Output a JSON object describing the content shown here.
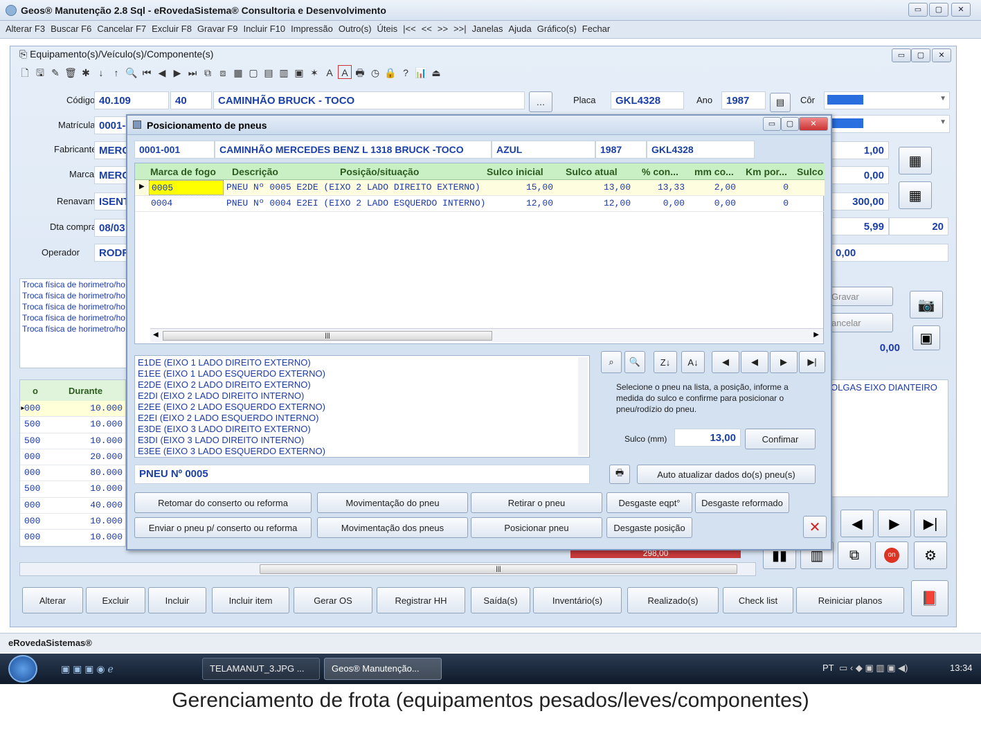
{
  "window": {
    "title": "Geos® Manutenção 2.8 Sql - eRovedaSistema® Consultoria e Desenvolvimento"
  },
  "menu": [
    "Alterar F3",
    "Buscar F6",
    "Cancelar F7",
    "Excluir F8",
    "Gravar F9",
    "Incluir F10",
    "Impressão",
    "Outro(s)",
    "Úteis",
    "|<<",
    "<<",
    ">>",
    ">>|",
    "Janelas",
    "Ajuda",
    "Gráfico(s)",
    "Fechar"
  ],
  "child": {
    "title": "Equipamento(s)/Veículo(s)/Componente(s)"
  },
  "form": {
    "codigo_label": "Código",
    "codigo": "40.109",
    "codigo2": "40",
    "descricao": "CAMINHÃO BRUCK - TOCO",
    "placa_label": "Placa",
    "placa": "GKL4328",
    "ano_label": "Ano",
    "ano": "1987",
    "cor_label": "Côr",
    "matricula_label": "Matrícula",
    "matricula": "0001-",
    "fabricante_label": "Fabricante",
    "fabricante": "MERC",
    "marca_label": "Marca",
    "marca": "MERC",
    "renavam_label": "Renavam",
    "renavam": "ISENT",
    "dtacompra_label": "Dta compra",
    "dtacompra": "08/03",
    "operador_label": "Operador",
    "operador": "RODR",
    "right_values": [
      "1,00",
      "0,00",
      "300,00",
      "5,99",
      "0,00"
    ],
    "right_extra": "20",
    "gravar": "Gravar",
    "cancelar": "ancelar",
    "right_total": "0,00",
    "troca": [
      "Troca física de horimetro/ho",
      "Troca física de horimetro/ho",
      "Troca física de horimetro/ho",
      "Troca física de horimetro/ho",
      "Troca física de horimetro/ho"
    ],
    "folgas": "OLGAS EIXO DIANTEIRO"
  },
  "left_grid": {
    "col_o": "o",
    "col_durante": "Durante",
    "rows": [
      [
        "000",
        "10.000"
      ],
      [
        "500",
        "10.000"
      ],
      [
        "500",
        "10.000"
      ],
      [
        "000",
        "20.000"
      ],
      [
        "000",
        "80.000"
      ],
      [
        "500",
        "10.000"
      ],
      [
        "000",
        "40.000"
      ],
      [
        "000",
        "10.000"
      ],
      [
        "000",
        "10.000"
      ]
    ],
    "total": "298,00"
  },
  "dialog": {
    "title": "Posicionamento de pneus",
    "header": [
      "0001-001",
      "CAMINHÃO MERCEDES BENZ L 1318  BRUCK -TOCO",
      "AZUL",
      "1987",
      "GKL4328"
    ],
    "columns": [
      "Marca de fogo",
      "Descrição",
      "Posição/situação",
      "Sulco inicial",
      "Sulco atual",
      "% con...",
      "mm co...",
      "Km por...",
      "Sulco"
    ],
    "rows": [
      [
        "0005",
        "PNEU Nº 0005 E2DE (EIXO 2 LADO DIREITO EXTERNO)",
        "15,00",
        "13,00",
        "13,33",
        "2,00",
        "0"
      ],
      [
        "0004",
        "PNEU Nº 0004 E2EI (EIXO 2 LADO ESQUERDO INTERNO)",
        "12,00",
        "12,00",
        "0,00",
        "0,00",
        "0"
      ]
    ],
    "positions": [
      "E1DE (EIXO 1 LADO DIREITO EXTERNO)",
      "E1EE (EIXO 1 LADO ESQUERDO EXTERNO)",
      "E2DE (EIXO 2 LADO DIREITO EXTERNO)",
      "E2DI (EIXO 2 LADO DIREITO INTERNO)",
      "E2EE (EIXO 2 LADO ESQUERDO EXTERNO)",
      "E2EI (EIXO 2 LADO ESQUERDO INTERNO)",
      "E3DE (EIXO 3 LADO DIREITO EXTERNO)",
      "E3DI (EIXO 3 LADO DIREITO INTERNO)",
      "E3EE (EIXO 3 LADO ESQUERDO EXTERNO)"
    ],
    "instructions": "Selecione o pneu na lista, a posição,          informe a medida do sulco e confirme para posicionar o pneu/rodízio do pneu.",
    "sulco_label": "Sulco (mm)",
    "sulco_value": "13,00",
    "confirmar": "Confimar",
    "selected": "PNEU Nº 0005",
    "auto": "Auto atualizar dados do(s) pneu(s)",
    "buttons_row1": [
      "Retomar do conserto ou reforma",
      "Movimentação do pneu",
      "Retirar o pneu",
      "Desgaste eqpt°",
      "Desgaste reformado"
    ],
    "buttons_row2": [
      "Enviar o pneu p/ conserto ou reforma",
      "Movimentação dos pneus",
      "Posicionar pneu",
      "Desgaste posição"
    ]
  },
  "bottom_buttons": [
    "Alterar",
    "Excluir",
    "Incluir",
    "Incluir item",
    "Gerar OS",
    "Registrar HH",
    "Saída(s)",
    "Inventário(s)",
    "Realizado(s)",
    "Check list",
    "Reiniciar planos"
  ],
  "status": "eRovedaSistemas®",
  "taskbar": {
    "items": [
      "TELAMANUT_3.JPG ...",
      "Geos® Manutenção..."
    ],
    "lang": "PT",
    "clock": "13:34"
  },
  "caption": "Gerenciamento de frota (equipamentos pesados/leves/componentes)",
  "colors": {
    "accent": "#1c3aa8",
    "grid_header": "#c9f0c4",
    "selected_cell": "#ffff00"
  }
}
